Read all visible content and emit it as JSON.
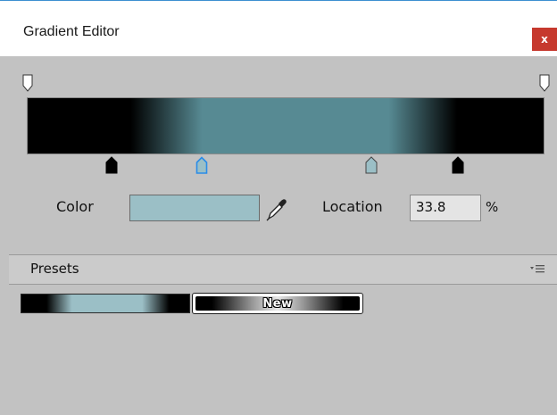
{
  "window": {
    "title": "Gradient Editor",
    "close_label": "x"
  },
  "gradient": {
    "stops": [
      {
        "position": 0.0,
        "color": "#000000"
      },
      {
        "position": 0.2,
        "color": "#000000"
      },
      {
        "position": 0.338,
        "color": "#578a93"
      },
      {
        "position": 0.7,
        "color": "#578a93"
      },
      {
        "position": 0.832,
        "color": "#000000"
      },
      {
        "position": 1.0,
        "color": "#000000"
      }
    ],
    "alpha_markers": [
      {
        "name": "alpha-marker-left",
        "position": 0.0,
        "value": 1.0
      },
      {
        "name": "alpha-marker-right",
        "position": 1.0,
        "value": 1.0
      }
    ],
    "color_markers": [
      {
        "name": "color-marker-1",
        "position": 0.164,
        "color": "#000000",
        "selected": false
      },
      {
        "name": "color-marker-2",
        "position": 0.338,
        "color": "#9bbfc6",
        "selected": true
      },
      {
        "name": "color-marker-3",
        "position": 0.664,
        "color": "#9bbfc6",
        "selected": false
      },
      {
        "name": "color-marker-4",
        "position": 0.832,
        "color": "#000000",
        "selected": false
      }
    ]
  },
  "editor": {
    "color_label": "Color",
    "color_value": "#9bbfc6",
    "location_label": "Location",
    "location_value": "33.8",
    "location_unit": "%"
  },
  "presets": {
    "header_label": "Presets",
    "new_button_label": "New",
    "items": [
      {
        "name": "preset-1",
        "stops": [
          "#000000",
          "#000000",
          "#9bbfc6",
          "#9bbfc6",
          "#000000",
          "#000000"
        ]
      }
    ]
  },
  "colors": {
    "accent": "#3c8fd0",
    "close": "#c6392e",
    "panel": "#c2c2c2",
    "selected_marker": "#2a8ce8"
  }
}
